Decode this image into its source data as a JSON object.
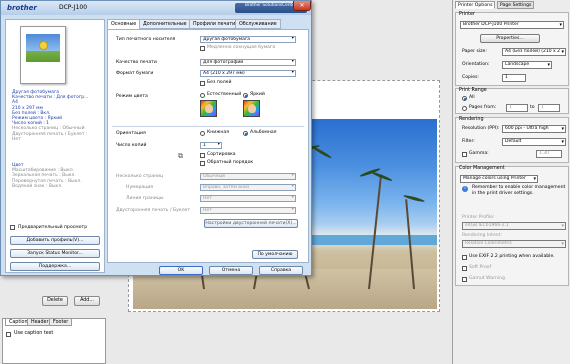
{
  "preview": {
    "left_buttons": {
      "delete": "Delete",
      "add": "Add..."
    },
    "bottom_tabs": [
      "Caption",
      "Header",
      "Footer"
    ],
    "use_caption": "Use caption text"
  },
  "right_panel": {
    "tabs": [
      "Printer Options",
      "Page Settings"
    ],
    "printer_group": "Printer",
    "printer_name": "Brother DCP-J100 Printer",
    "properties": "Properties...",
    "paper_size_label": "Paper size:",
    "paper_size_value": "A4 (Без полей) (210 x 2",
    "orientation_label": "Orientation:",
    "orientation_value": "Landscape",
    "copies_label": "Copies:",
    "copies_value": "1",
    "print_range_group": "Print Range",
    "all_label": "All",
    "pages_from_label": "Pages from:",
    "pages_from": "1",
    "to_label": "to",
    "pages_to": "1",
    "rendering_group": "Rendering",
    "resolution_label": "Resolution (PPI):",
    "resolution_value": "600 ppi - Ultra high",
    "filter_label": "Filter:",
    "filter_value": "Default",
    "gamma_label": "Gamma:",
    "gamma_value": "1.30",
    "color_mgmt_group": "Color Management",
    "color_mgmt_value": "Manage colors using Printer",
    "note": "Remember to enable color management in the print driver settings.",
    "printer_profile_label": "Printer Profile:",
    "printer_profile_value": "sRGB IEC61966-2.1",
    "rendering_intent_label": "Rendering Intent:",
    "rendering_intent_value": "Relative Colorimetric",
    "use_exif": "Use EXIF 2.2 printing when available.",
    "soft_proof": "Soft Proof",
    "gamut_warning": "Gamut Warning"
  },
  "dialog": {
    "brand": "brother",
    "model": "DCP-J100",
    "logo_text": "Brother SolutionsCenter",
    "tabs": [
      "Основные",
      "Дополнительные",
      "Профили печати",
      "Обслуживание"
    ],
    "left_info": [
      "Другая фотобумага",
      "Качество печати : Для фотогр...",
      "A4",
      "210 x 297 мм",
      "Без полей : Вкл.",
      "Режим цвета : Яркий",
      "Число копий : 1",
      "Несколько страниц : Обычный",
      "Двусторонняя печать / Буклет :",
      "Нет"
    ],
    "left_info2": [
      "Цвет",
      "Масштабирование : Выкл.",
      "Зеркальная печать : Выкл.",
      "Перевернутая печать : Выкл.",
      "Водяной знак : Выкл."
    ],
    "preview_check": "Предварительный просмотр",
    "add_profile": "Добавить профиль(V)...",
    "status_monitor": "Запуск Status Monitor...",
    "support": "Поддержка...",
    "media_type_label": "Тип печатного носителя",
    "media_type_value": "Другая фотобумага",
    "slow_dry": "Медленно сохнущая бумага",
    "quality_label": "Качество печати",
    "quality_value": "Для фотографий",
    "paper_label": "Формат бумаги",
    "paper_value": "A4 (210 x 297 мм)",
    "borderless": "Без полей",
    "color_mode_label": "Режим цвета",
    "natural": "Естественный",
    "vivid": "Яркий",
    "orientation_label": "Ориентация",
    "portrait": "Книжная",
    "landscape": "Альбомная",
    "copies_label": "Число копий",
    "copies_value": "1",
    "collate": "Сортировка",
    "reverse": "Обратный порядок",
    "multipage_label": "Несколько страниц",
    "multipage_value": "Обычный",
    "page_order_label": "Нумерация",
    "page_order_value": "Вправо, затем вниз",
    "border_label": "Линия границы",
    "border_value": "Нет",
    "duplex_label": "Двусторонняя печать / Буклет",
    "duplex_value": "Нет",
    "duplex_settings": "Настройки двусторонней печати(X)...",
    "default_btn": "По умолчанию",
    "ok": "OK",
    "cancel": "Отмена",
    "help": "Справка"
  }
}
